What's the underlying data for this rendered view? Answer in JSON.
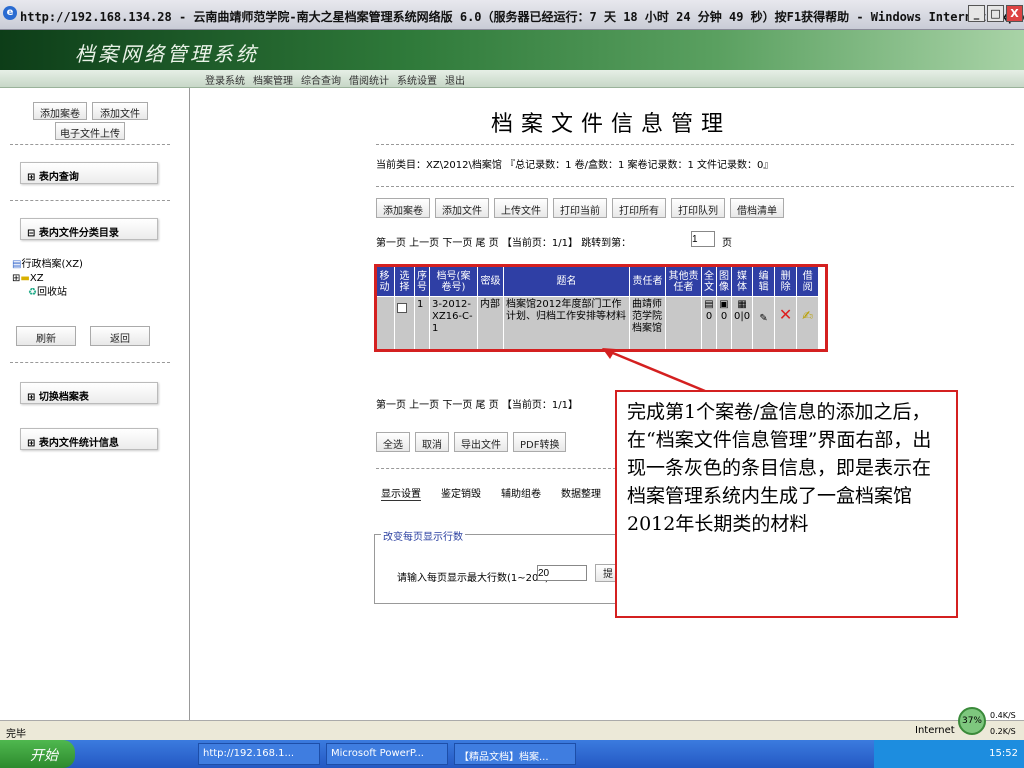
{
  "window": {
    "title": "http://192.168.134.28 - 云南曲靖师范学院-南大之星档案管理系统网络版 6.0（服务器已经运行：7 天 18 小时 24 分钟 49 秒）按F1获得帮助 - Windows Internet Explorer",
    "min": "_",
    "max": "□",
    "close": "X"
  },
  "banner": {
    "logo": "档案网络管理系统"
  },
  "menu": [
    "登录系统",
    "档案管理",
    "综合查询",
    "借阅统计",
    "系统设置",
    "退出"
  ],
  "left": {
    "add_volume": "添加案卷",
    "add_file": "添加文件",
    "e_upload": "电子文件上传",
    "query": "表内查询",
    "catalog": "表内文件分类目录",
    "tree_root": "行政档案(XZ)",
    "tree_xz": "XZ",
    "tree_recycle": "回收站",
    "refresh": "刷新",
    "back": "返回",
    "switch": "切换档案表",
    "stats": "表内文件统计信息",
    "expand": "⊞",
    "collapse": "⊟"
  },
  "main": {
    "title": "档案文件信息管理",
    "category": "当前类目：XZ\\2012\\档案馆 『总记录数：1 卷/盒数：1 案卷记录数：1 文件记录数：0』",
    "toolbar": [
      "添加案卷",
      "添加文件",
      "上传文件",
      "打印当前",
      "打印所有",
      "打印队列",
      "借档清单"
    ],
    "pager_top": "第一页 上一页 下一页 尾 页 【当前页：1/1】  跳转到第：",
    "jump_value": "1",
    "page_suffix": "页",
    "table": {
      "headers": [
        "移动",
        "选择",
        "序号",
        "档号(案卷号)",
        "密级",
        "题名",
        "责任者",
        "其他责任者",
        "全文",
        "图像",
        "媒体",
        "编辑",
        "删除",
        "借阅"
      ],
      "row": {
        "seq": "1",
        "code": "3-2012-XZ16-C-1",
        "secret": "内部",
        "title": "档案馆2012年度部门工作计划、归档工作安排等材料",
        "owner": "曲靖师范学院档案馆",
        "full": "0",
        "image": "0",
        "media": "0|0"
      }
    },
    "pager_bottom": "第一页 上一页 下一页 尾 页 【当前页：1/1】",
    "actions": [
      "全选",
      "取消",
      "导出文件",
      "PDF转换"
    ],
    "tabs": [
      "显示设置",
      "鉴定销毁",
      "辅助组卷",
      "数据整理"
    ],
    "fieldset_legend": "改变每页显示行数",
    "rows_label": "请输入每页显示最大行数(1~200)",
    "rows_value": "20",
    "submit": "提"
  },
  "callout": "完成第1个案卷/盒信息的添加之后，在“档案文件信息管理”界面右部，出现一条灰色的条目信息，即是表示在档案管理系统内生成了一盒档案馆2012年长期类的材料",
  "status": {
    "left": "完毕",
    "zone": "Internet",
    "pct": "37%",
    "up": "0.4K/S",
    "down": "0.2K/S"
  },
  "taskbar": {
    "start": "开始",
    "tasks": [
      "http://192.168.1...",
      "Microsoft PowerP...",
      "【精品文档】档案..."
    ],
    "time": "15:52"
  }
}
